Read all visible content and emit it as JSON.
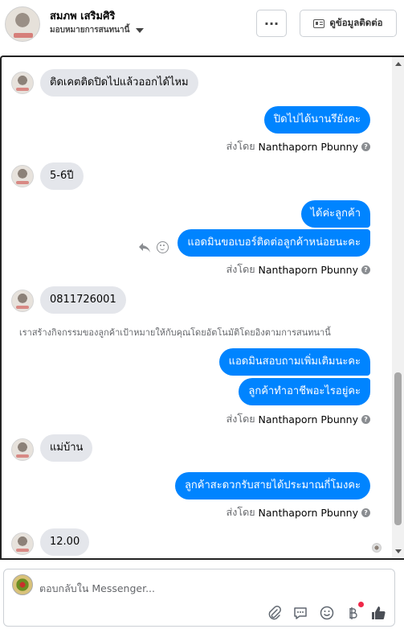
{
  "header": {
    "contact_name": "สมภพ เสริมศิริ",
    "assign_label": "มอบหมายการสนทนานี้",
    "more_label": "···",
    "contact_info_label": "ดูข้อมูลติดต่อ"
  },
  "messages": [
    {
      "id": "m1",
      "direction": "in",
      "text": "ติดเคตติดปิดไปแล้วออกได้ไหม"
    },
    {
      "id": "m2",
      "direction": "out",
      "text": "ปิดไปได้นานรึยังคะ"
    },
    {
      "id": "s1",
      "type": "sent_by",
      "prefix": "ส่งโดย",
      "name": "Nanthaporn Pbunny"
    },
    {
      "id": "m3",
      "direction": "in",
      "text": "5-6ปี"
    },
    {
      "id": "m4",
      "direction": "out",
      "text": "ได้ค่ะลูกค้า"
    },
    {
      "id": "m5",
      "direction": "out",
      "text": "แอดมินขอเบอร์ติดต่อลูกค้าหน่อยนะคะ"
    },
    {
      "id": "s2",
      "type": "sent_by",
      "prefix": "ส่งโดย",
      "name": "Nanthaporn Pbunny"
    },
    {
      "id": "m6",
      "direction": "in",
      "text": "0811726001"
    },
    {
      "id": "n1",
      "type": "system",
      "text": "เราสร้างกิจกรรมของลูกค้าเป้าหมายให้กับคุณโดยอัตโนมัติโดยอิงตามการสนทนานี้"
    },
    {
      "id": "m7",
      "direction": "out",
      "text": "แอดมินสอบถามเพิ่มเติมนะคะ"
    },
    {
      "id": "m8",
      "direction": "out",
      "text": "ลูกค้าทำอาชีพอะไรอยู่คะ"
    },
    {
      "id": "s3",
      "type": "sent_by",
      "prefix": "ส่งโดย",
      "name": "Nanthaporn Pbunny"
    },
    {
      "id": "m9",
      "direction": "in",
      "text": "แม่บ้าน"
    },
    {
      "id": "m10",
      "direction": "out",
      "text": "ลูกค้าสะดวกรับสายได้ประมาณกี่โมงคะ"
    },
    {
      "id": "s4",
      "type": "sent_by",
      "prefix": "ส่งโดย",
      "name": "Nanthaporn Pbunny"
    },
    {
      "id": "m11",
      "direction": "in",
      "text": "12.00"
    }
  ],
  "help_icon": "?",
  "composer": {
    "placeholder": "ตอบกลับใน Messenger..."
  },
  "icons": {
    "attach": "paperclip-icon",
    "saved_replies": "chat-bubble-icon",
    "emoji": "smile-icon",
    "payment": "baht-icon",
    "like": "thumbs-up-icon"
  },
  "colors": {
    "outgoing_bubble": "#0084ff",
    "incoming_bubble": "#e4e6eb",
    "notification_dot": "#f02849"
  }
}
